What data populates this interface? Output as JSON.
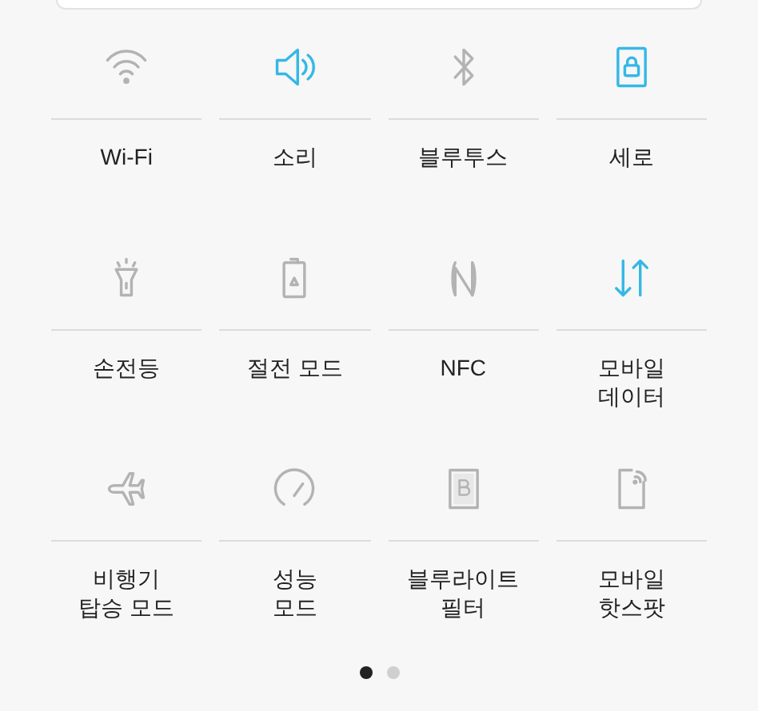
{
  "tiles": [
    {
      "kind": "wifi",
      "label": "Wi-Fi",
      "on": false
    },
    {
      "kind": "sound",
      "label": "소리",
      "on": true
    },
    {
      "kind": "bluetooth",
      "label": "블루투스",
      "on": false
    },
    {
      "kind": "portrait",
      "label": "세로",
      "on": true
    },
    {
      "kind": "flashlight",
      "label": "손전등",
      "on": false
    },
    {
      "kind": "power_saving",
      "label": "절전 모드",
      "on": false
    },
    {
      "kind": "nfc",
      "label": "NFC",
      "on": false
    },
    {
      "kind": "mobile_data",
      "label": "모바일\n데이터",
      "on": true
    },
    {
      "kind": "airplane",
      "label": "비행기\n탑승 모드",
      "on": false
    },
    {
      "kind": "performance",
      "label": "성능\n모드",
      "on": false
    },
    {
      "kind": "blue_light",
      "label": "블루라이트\n필터",
      "on": false
    },
    {
      "kind": "hotspot",
      "label": "모바일\n핫스팟",
      "on": false
    }
  ],
  "pages": [
    {
      "selected": true
    },
    {
      "selected": false
    }
  ]
}
